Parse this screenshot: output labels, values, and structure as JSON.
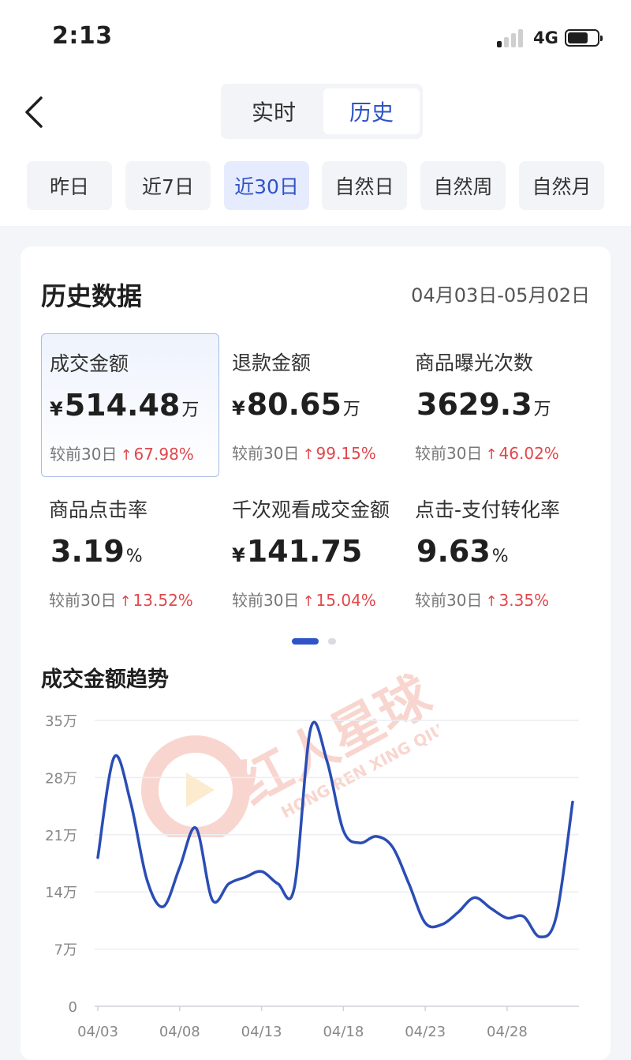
{
  "status_bar": {
    "time": "2:13",
    "network": "4G",
    "battery_level": 0.7
  },
  "nav": {
    "back_icon": "chevron-left-icon"
  },
  "tabs": [
    {
      "label": "实时",
      "active": false
    },
    {
      "label": "历史",
      "active": true
    }
  ],
  "period_chips": [
    {
      "label": "昨日",
      "active": false
    },
    {
      "label": "近7日",
      "active": false
    },
    {
      "label": "近30日",
      "active": true
    },
    {
      "label": "自然日",
      "active": false
    },
    {
      "label": "自然周",
      "active": false
    },
    {
      "label": "自然月",
      "active": false
    }
  ],
  "history": {
    "title": "历史数据",
    "date_range": "04月03日-05月02日",
    "metrics": [
      {
        "label": "成交金额",
        "currency": "¥",
        "value": "514.48",
        "unit": "万",
        "compare_label": "较前30日",
        "change": "67.98%",
        "selected": true
      },
      {
        "label": "退款金额",
        "currency": "¥",
        "value": "80.65",
        "unit": "万",
        "compare_label": "较前30日",
        "change": "99.15%",
        "selected": false
      },
      {
        "label": "商品曝光次数",
        "currency": "",
        "value": "3629.3",
        "unit": "万",
        "compare_label": "较前30日",
        "change": "46.02%",
        "selected": false
      },
      {
        "label": "商品点击率",
        "currency": "",
        "value": "3.19",
        "unit": "%",
        "compare_label": "较前30日",
        "change": "13.52%",
        "selected": false
      },
      {
        "label": "千次观看成交金额",
        "currency": "¥",
        "value": "141.75",
        "unit": "",
        "compare_label": "较前30日",
        "change": "15.04%",
        "selected": false
      },
      {
        "label": "点击-支付转化率",
        "currency": "",
        "value": "9.63",
        "unit": "%",
        "compare_label": "较前30日",
        "change": "3.35%",
        "selected": false
      }
    ],
    "pager": {
      "pages": 2,
      "current": 1
    }
  },
  "watermark": {
    "text": "红人星球",
    "subtext": "HONG REN XING QIU"
  },
  "trend": {
    "title": "成交金额趋势"
  },
  "colors": {
    "accent": "#3054c7",
    "increase": "#e2474b",
    "line": "#2a4db5"
  },
  "chart_data": {
    "type": "line",
    "title": "成交金额趋势",
    "xlabel": "",
    "ylabel": "",
    "ylim": [
      0,
      35
    ],
    "y_unit": "万",
    "y_ticks": [
      "0",
      "7万",
      "14万",
      "21万",
      "28万",
      "35万"
    ],
    "y_tick_values": [
      0,
      7,
      14,
      21,
      28,
      35
    ],
    "x_tick_labels": [
      "04/03",
      "04/08",
      "04/13",
      "04/18",
      "04/23",
      "04/28"
    ],
    "x": [
      "04/03",
      "04/04",
      "04/05",
      "04/06",
      "04/07",
      "04/08",
      "04/09",
      "04/10",
      "04/11",
      "04/12",
      "04/13",
      "04/14",
      "04/15",
      "04/16",
      "04/17",
      "04/18",
      "04/19",
      "04/20",
      "04/21",
      "04/22",
      "04/23",
      "04/24",
      "04/25",
      "04/26",
      "04/27",
      "04/28",
      "04/29",
      "04/30",
      "05/01",
      "05/02"
    ],
    "series": [
      {
        "values": [
          18.2,
          30.5,
          25.0,
          15.5,
          12.2,
          17.0,
          21.8,
          13.0,
          15.0,
          15.8,
          16.5,
          15.0,
          14.5,
          34.0,
          30.0,
          21.5,
          20.0,
          20.8,
          19.5,
          15.0,
          10.2,
          10.0,
          11.5,
          13.3,
          12.0,
          10.8,
          11.0,
          8.5,
          11.0,
          25.0
        ]
      }
    ],
    "grid": true,
    "legend": "none"
  }
}
